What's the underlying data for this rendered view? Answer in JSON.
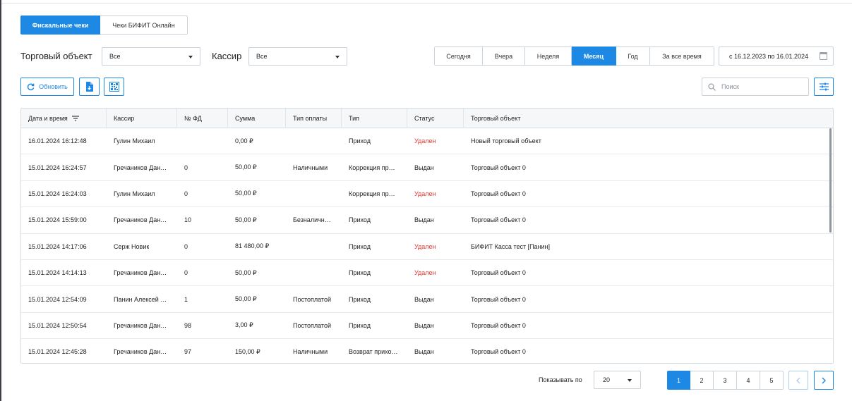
{
  "tabs": [
    {
      "label": "Фискальные чеки",
      "active": true
    },
    {
      "label": "Чеки БИФИТ Онлайн",
      "active": false
    }
  ],
  "filters": {
    "store_label": "Торговый объект",
    "store_value": "Все",
    "cashier_label": "Кассир",
    "cashier_value": "Все"
  },
  "periods": [
    {
      "label": "Сегодня",
      "active": false
    },
    {
      "label": "Вчера",
      "active": false
    },
    {
      "label": "Неделя",
      "active": false
    },
    {
      "label": "Месяц",
      "active": true
    },
    {
      "label": "Год",
      "active": false
    },
    {
      "label": "За все время",
      "active": false
    }
  ],
  "date_range": "с 16.12.2023  по 16.01.2024",
  "toolbar": {
    "refresh_label": "Обновить",
    "search_placeholder": "Поиск"
  },
  "table": {
    "columns": [
      "Дата и время",
      "Кассир",
      "№ ФД",
      "Сумма",
      "Тип оплаты",
      "Тип",
      "Статус",
      "Торговый объект"
    ],
    "rows": [
      {
        "datetime": "16.01.2024 16:12:48",
        "cashier": "Гулин Михаил",
        "fd": "",
        "sum": "0,00 ₽",
        "payment": "",
        "type": "Приход",
        "status": "Удален",
        "deleted": true,
        "store": "Новый торговый объект"
      },
      {
        "datetime": "15.01.2024 16:24:57",
        "cashier": "Гречаников Дан…",
        "fd": "0",
        "sum": "50,00 ₽",
        "payment": "Наличными",
        "type": "Коррекция пр…",
        "status": "Выдан",
        "deleted": false,
        "store": "Торговый объект 0"
      },
      {
        "datetime": "15.01.2024 16:24:03",
        "cashier": "Гулин Михаил",
        "fd": "0",
        "sum": "50,00 ₽",
        "payment": "",
        "type": "Коррекция пр…",
        "status": "Удален",
        "deleted": true,
        "store": "Торговый объект 0"
      },
      {
        "datetime": "15.01.2024 15:59:00",
        "cashier": "Гречаников Дан…",
        "fd": "10",
        "sum": "50,00 ₽",
        "payment": "Безналичн…",
        "type": "Приход",
        "status": "Выдан",
        "deleted": false,
        "store": "Торговый объект 0"
      },
      {
        "datetime": "15.01.2024 14:17:06",
        "cashier": "Серж Новик",
        "fd": "0",
        "sum": "81 480,00 ₽",
        "payment": "",
        "type": "Приход",
        "status": "Удален",
        "deleted": true,
        "store": "БИФИТ Касса тест [Панин]"
      },
      {
        "datetime": "15.01.2024 14:14:13",
        "cashier": "Гречаников Дан…",
        "fd": "0",
        "sum": "50,00 ₽",
        "payment": "",
        "type": "Приход",
        "status": "Удален",
        "deleted": true,
        "store": "Торговый объект 0"
      },
      {
        "datetime": "15.01.2024 12:54:09",
        "cashier": "Панин Алексей …",
        "fd": "1",
        "sum": "50,00 ₽",
        "payment": "Постоплатой",
        "type": "Приход",
        "status": "Выдан",
        "deleted": false,
        "store": "Торговый объект 0"
      },
      {
        "datetime": "15.01.2024 12:50:54",
        "cashier": "Гречаников Дан…",
        "fd": "98",
        "sum": "3,00 ₽",
        "payment": "Постоплатой",
        "type": "Приход",
        "status": "Выдан",
        "deleted": false,
        "store": "Торговый объект 0"
      },
      {
        "datetime": "15.01.2024 12:45:28",
        "cashier": "Гречаников Дан…",
        "fd": "97",
        "sum": "150,00 ₽",
        "payment": "Наличными",
        "type": "Возврат прихо…",
        "status": "Выдан",
        "deleted": false,
        "store": "Торговый объект 0"
      }
    ]
  },
  "pagination": {
    "per_page_label": "Показывать по",
    "per_page_value": "20",
    "pages": [
      "1",
      "2",
      "3",
      "4",
      "5"
    ],
    "current": "1"
  },
  "colors": {
    "accent": "#1e88e5",
    "deleted": "#e53935"
  }
}
